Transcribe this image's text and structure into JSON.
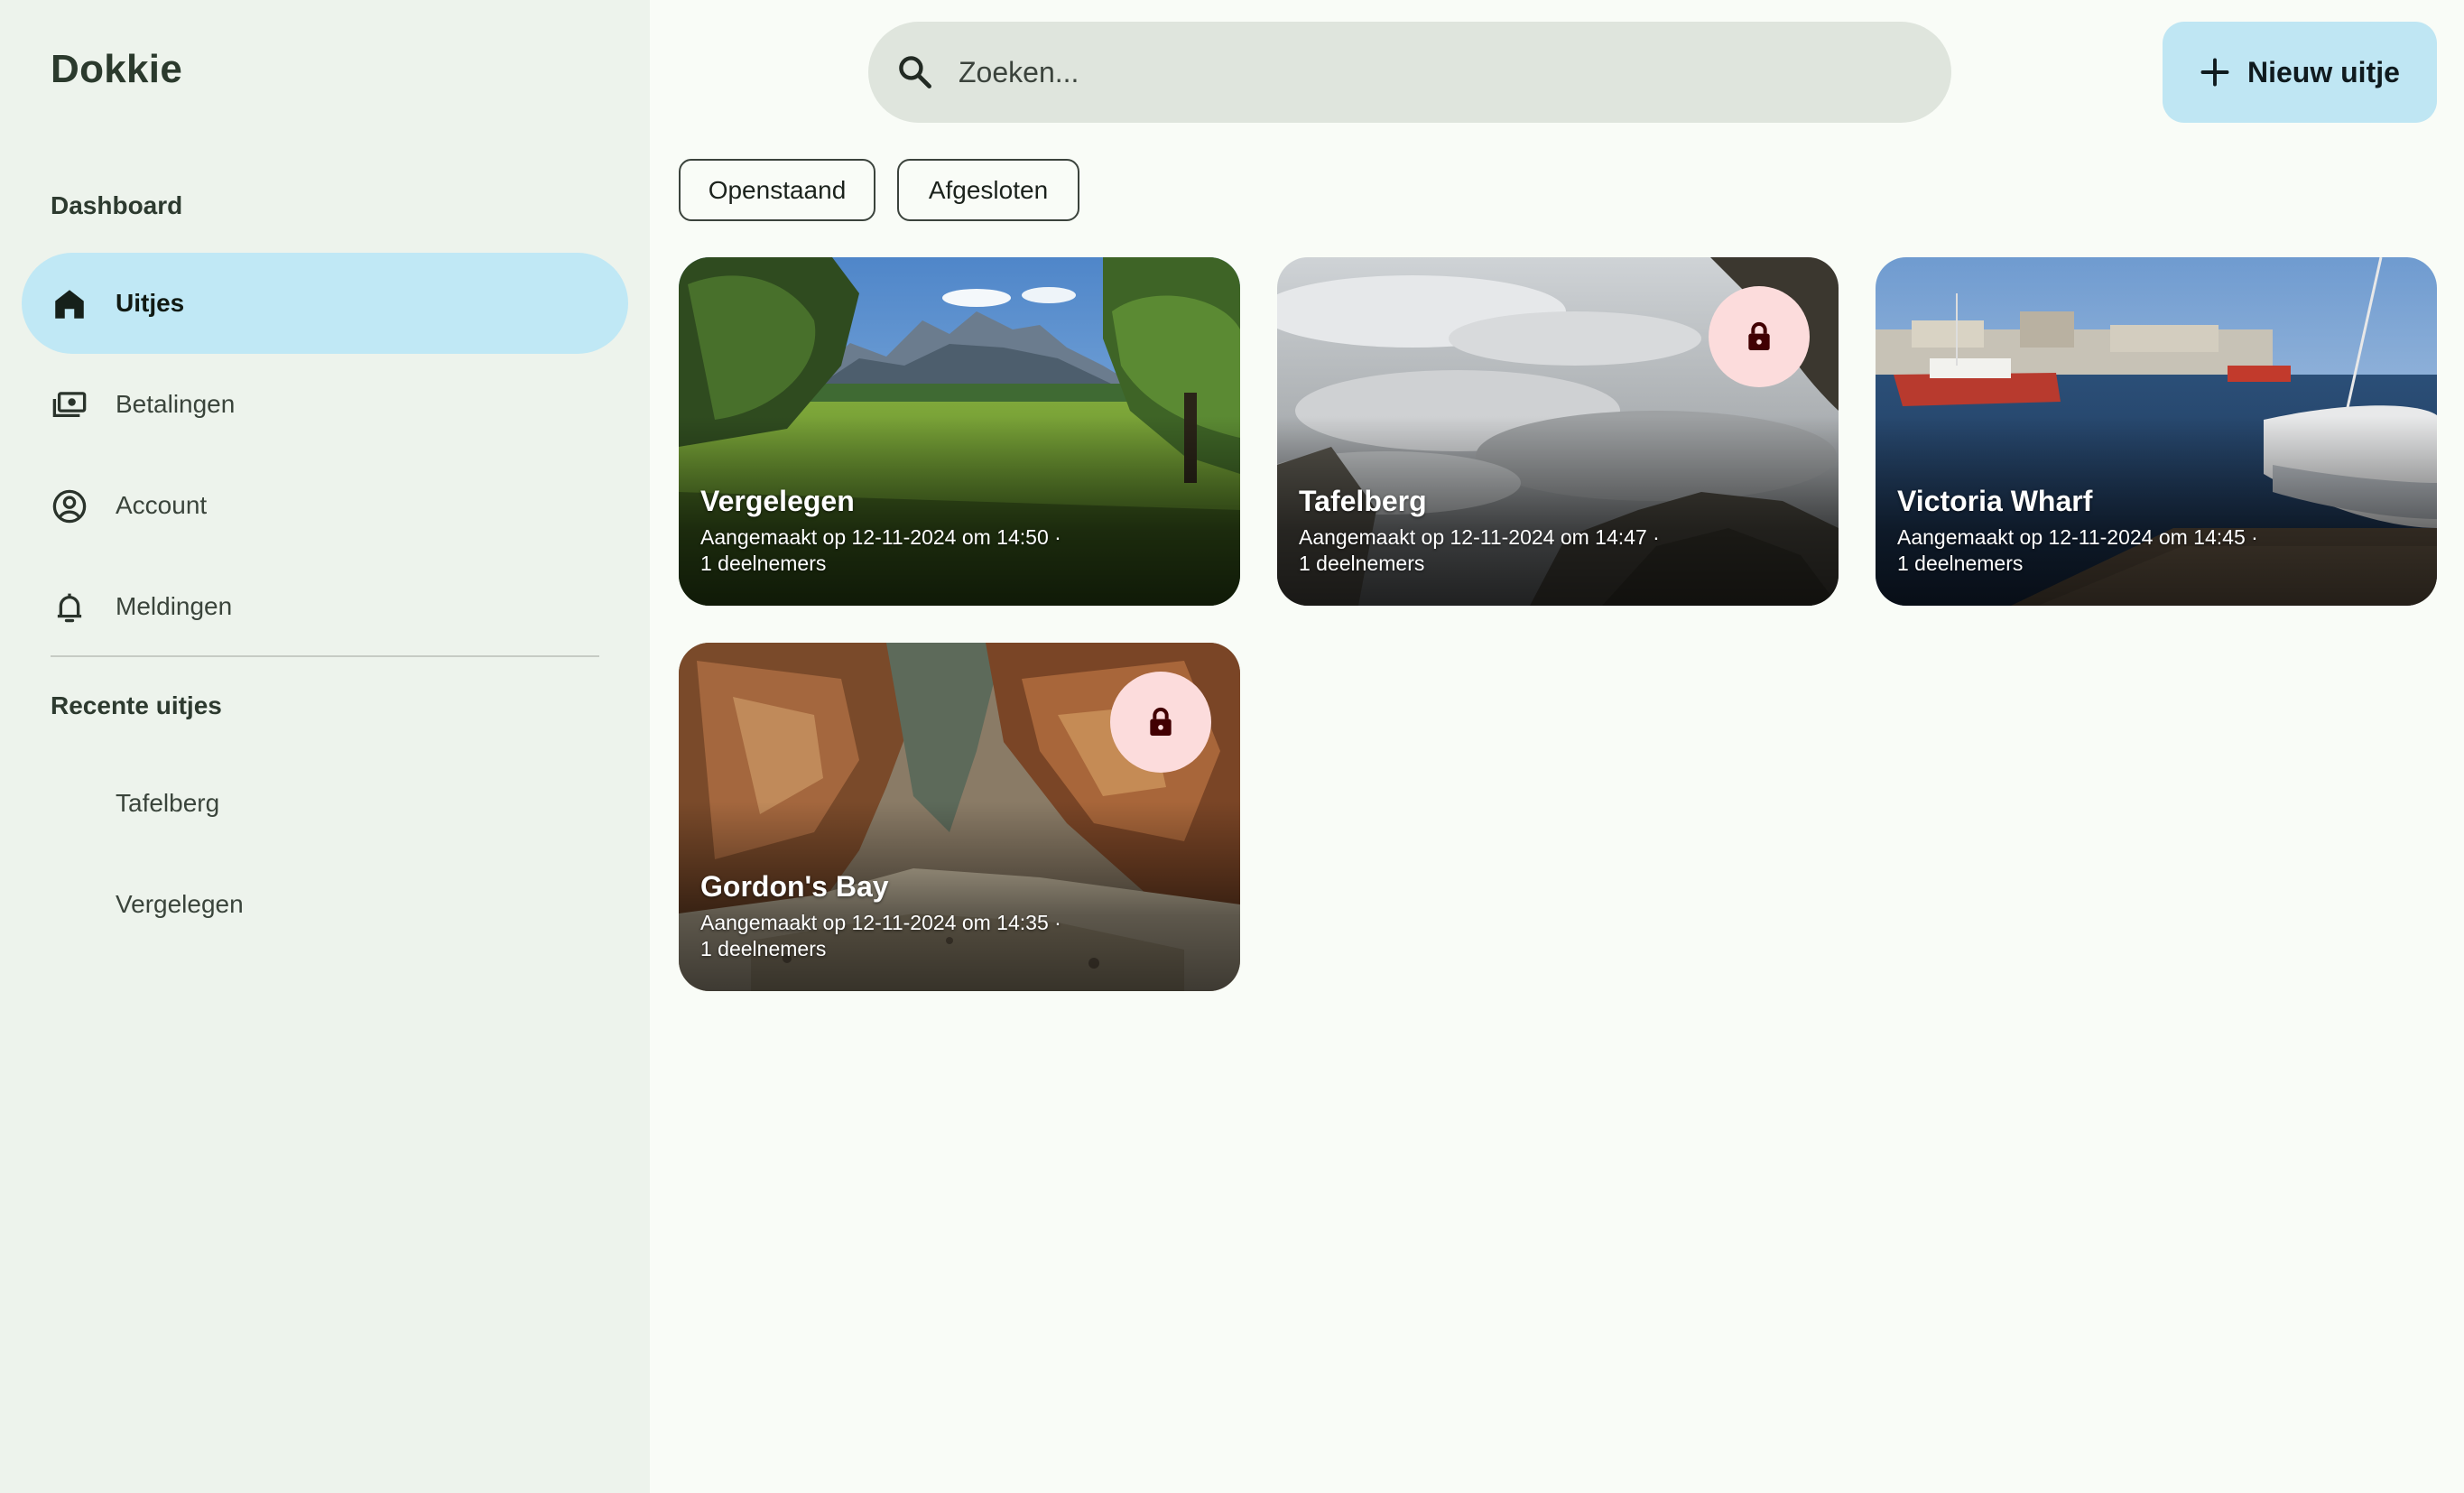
{
  "app": {
    "title": "Dokkie"
  },
  "sidebar": {
    "section_dashboard": "Dashboard",
    "items": [
      {
        "label": "Uitjes",
        "icon": "home-icon",
        "active": true
      },
      {
        "label": "Betalingen",
        "icon": "payments-icon",
        "active": false
      },
      {
        "label": "Account",
        "icon": "account-icon",
        "active": false
      },
      {
        "label": "Meldingen",
        "icon": "bell-icon",
        "active": false
      }
    ],
    "section_recent": "Recente uitjes",
    "recent": [
      {
        "label": "Tafelberg"
      },
      {
        "label": "Vergelegen"
      }
    ]
  },
  "search": {
    "placeholder": "Zoeken...",
    "value": "",
    "icon": "search-icon"
  },
  "new_button": {
    "label": "Nieuw uitje",
    "icon": "plus-icon"
  },
  "filters": [
    {
      "label": "Openstaand"
    },
    {
      "label": "Afgesloten"
    }
  ],
  "cards": [
    {
      "title": "Vergelegen",
      "meta_line1": "Aangemaakt op 12-11-2024 om 14:50 ·",
      "meta_line2": "1 deelnemers",
      "locked": false
    },
    {
      "title": "Tafelberg",
      "meta_line1": "Aangemaakt op 12-11-2024 om 14:47 ·",
      "meta_line2": "1 deelnemers",
      "locked": true
    },
    {
      "title": "Victoria Wharf",
      "meta_line1": "Aangemaakt op 12-11-2024 om 14:45 ·",
      "meta_line2": "1 deelnemers",
      "locked": false
    },
    {
      "title": "Gordon's Bay",
      "meta_line1": "Aangemaakt op 12-11-2024 om 14:35 ·",
      "meta_line2": "1 deelnemers",
      "locked": true
    }
  ],
  "colors": {
    "sidebar_bg": "#edf3ec",
    "active_nav": "#c0e8f5",
    "search_bg": "#dfe5dd",
    "primary_button": "#bfe6f3",
    "lock_badge": "#fcdcdc",
    "lock_icon": "#410002"
  }
}
